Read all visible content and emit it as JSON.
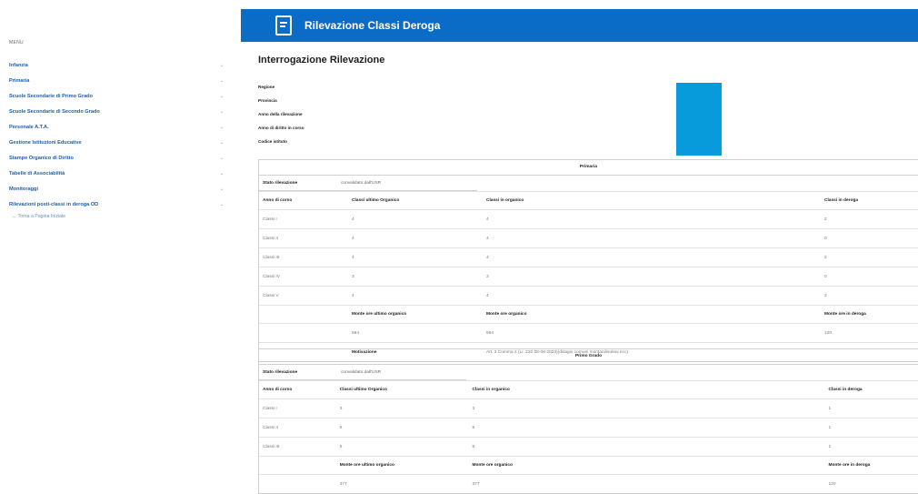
{
  "header": {
    "title": "Rilevazione Classi Deroga"
  },
  "sidebar": {
    "menu_label": "MENU",
    "items": [
      {
        "label": "Infanzia"
      },
      {
        "label": "Primaria"
      },
      {
        "label": "Scuole Secondarie di Primo Grado"
      },
      {
        "label": "Scuole Secondarie di Secondo Grado"
      },
      {
        "label": "Personale A.T.A."
      },
      {
        "label": "Gestione Istituzioni Educative"
      },
      {
        "label": "Stampe Organico di Diritto"
      },
      {
        "label": "Tabelle di Associabilità"
      },
      {
        "label": "Monitoraggi"
      },
      {
        "label": "Rilevazioni posti-classi in deroga OD"
      }
    ],
    "back_link": "← Torna a Pagina Iniziale"
  },
  "main": {
    "title": "Interrogazione Rilevazione",
    "info": [
      "Regione",
      "Provincia",
      "Anno della rilevazione",
      "Anno di diritto in corso",
      "Codice istituto"
    ],
    "primaria": {
      "header": "Primaria",
      "stato_label": "Stato rilevazione",
      "stato_value": "convalidato dall'USR",
      "cols": [
        "Anno di corso",
        "Classi ultimo Organico",
        "Classi in organico",
        "Classi in deroga"
      ],
      "rows": [
        [
          "Classi I",
          "4",
          "4",
          "2"
        ],
        [
          "Classi II",
          "4",
          "4",
          "0"
        ],
        [
          "Classi III",
          "4",
          "4",
          "2"
        ],
        [
          "Classi IV",
          "3",
          "3",
          "0"
        ],
        [
          "Classi V",
          "4",
          "4",
          "2"
        ]
      ],
      "monte_cols": [
        "Monte ore ultimo organico",
        "Monte ore organico",
        "Monte ore in deroga"
      ],
      "monte_vals": [
        "594",
        "594",
        "120"
      ],
      "motivazione_label": "Motivazione",
      "motivazione_value": "Art. 3 Comma 2 (Lr. 220 08-08-2023)(disagio comuni montani/isolani ecc)"
    },
    "primo_grado": {
      "header": "Primo Grado",
      "stato_label": "Stato rilevazione",
      "stato_value": "convalidato dall'USR",
      "cols": [
        "Anno di corso",
        "Classi ultimo Organico",
        "Classi in organico",
        "Classi in deroga"
      ],
      "rows": [
        [
          "Classi I",
          "3",
          "3",
          "1"
        ],
        [
          "Classi II",
          "5",
          "5",
          "1"
        ],
        [
          "Classi III",
          "5",
          "5",
          "1"
        ]
      ],
      "monte_cols": [
        "Monte ore ultimo organico",
        "Monte ore organico",
        "Monte ore in deroga"
      ],
      "monte_vals": [
        "377",
        "377",
        "120"
      ]
    }
  }
}
